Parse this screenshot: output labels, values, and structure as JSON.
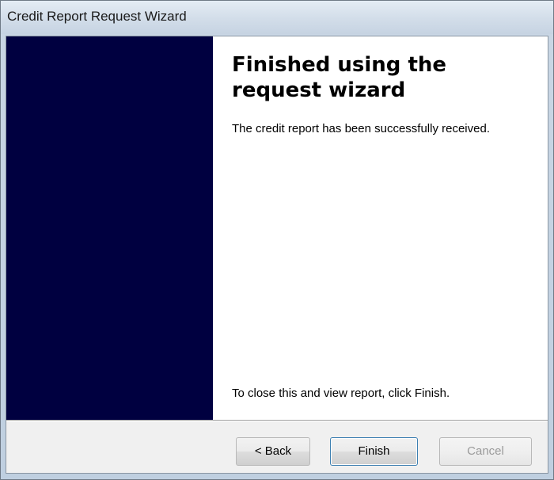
{
  "window": {
    "title": "Credit Report Request Wizard"
  },
  "content": {
    "heading": "Finished using the request wizard",
    "message": "The credit report has been successfully received.",
    "footer_hint": "To close this and view report, click Finish."
  },
  "buttons": {
    "back_label": "< Back",
    "finish_label": "Finish",
    "cancel_label": "Cancel",
    "cancel_enabled": false
  },
  "colors": {
    "side_panel": "#000040",
    "content_background": "#ffffff",
    "dialog_background": "#f0f0f0"
  }
}
